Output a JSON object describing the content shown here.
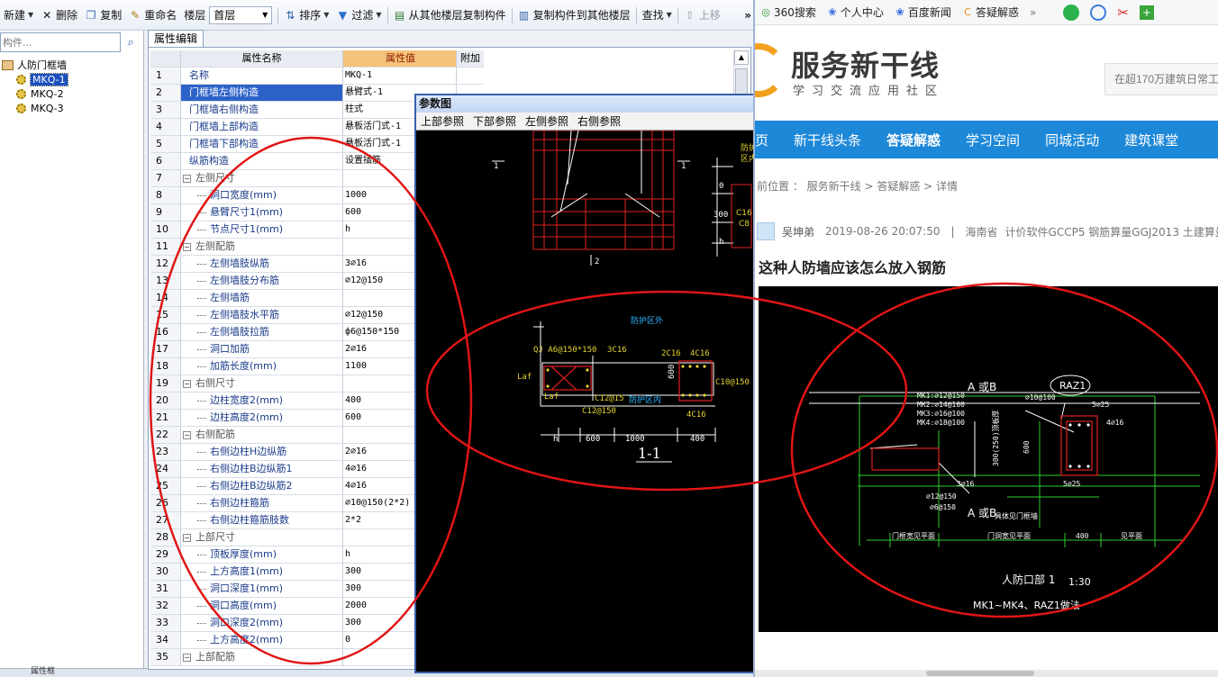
{
  "toolbar": {
    "new": "新建",
    "delete": "删除",
    "copy": "复制",
    "rename": "重命名",
    "floor_label": "楼层",
    "floor_value": "首层",
    "sort": "排序",
    "filter": "过滤",
    "copy_from_floor": "从其他楼层复制构件",
    "copy_to_floor": "复制构件到其他楼层",
    "find": "查找",
    "move_up": "上移"
  },
  "tree": {
    "search_placeholder": "构件...",
    "root": "人防门框墙",
    "items": [
      "MKQ-1",
      "MKQ-2",
      "MKQ-3"
    ],
    "selected": "MKQ-1"
  },
  "status": {
    "bottom_label": "属性框"
  },
  "property_panel": {
    "tab": "属性编辑",
    "headers": {
      "name": "属性名称",
      "value": "属性值",
      "extra": "附加"
    },
    "rows": [
      {
        "num": "1",
        "name": "名称",
        "value": "MKQ-1",
        "level": 1
      },
      {
        "num": "2",
        "name": "门框墙左侧构造",
        "value": "悬臂式-1",
        "level": 1,
        "selected": true
      },
      {
        "num": "3",
        "name": "门框墙右侧构造",
        "value": "柱式",
        "level": 1
      },
      {
        "num": "4",
        "name": "门框墙上部构造",
        "value": "悬板活门式-1",
        "level": 1
      },
      {
        "num": "5",
        "name": "门框墙下部构造",
        "value": "悬板活门式-1",
        "level": 1
      },
      {
        "num": "6",
        "name": "纵筋构造",
        "value": "设置插筋",
        "level": 1
      },
      {
        "num": "7",
        "name": "左侧尺寸",
        "value": "",
        "group": true
      },
      {
        "num": "8",
        "name": "洞口宽度(mm)",
        "value": "1000",
        "level": 2
      },
      {
        "num": "9",
        "name": "悬臂尺寸1(mm)",
        "value": "600",
        "level": 2
      },
      {
        "num": "10",
        "name": "节点尺寸1(mm)",
        "value": "h",
        "level": 2
      },
      {
        "num": "11",
        "name": "左侧配筋",
        "value": "",
        "group": true
      },
      {
        "num": "12",
        "name": "左侧墙肢纵筋",
        "value": "3⌀16",
        "level": 2
      },
      {
        "num": "13",
        "name": "左侧墙肢分布筋",
        "value": "⌀12@150",
        "level": 2
      },
      {
        "num": "14",
        "name": "左侧墙筋",
        "value": "",
        "level": 2
      },
      {
        "num": "15",
        "name": "左侧墙肢水平筋",
        "value": "⌀12@150",
        "level": 2
      },
      {
        "num": "16",
        "name": "左侧墙肢拉筋",
        "value": "ф6@150*150",
        "level": 2
      },
      {
        "num": "17",
        "name": "洞口加筋",
        "value": "2⌀16",
        "level": 2
      },
      {
        "num": "18",
        "name": "加筋长度(mm)",
        "value": "1100",
        "level": 2
      },
      {
        "num": "19",
        "name": "右侧尺寸",
        "value": "",
        "group": true
      },
      {
        "num": "20",
        "name": "边柱宽度2(mm)",
        "value": "400",
        "level": 2
      },
      {
        "num": "21",
        "name": "边柱高度2(mm)",
        "value": "600",
        "level": 2
      },
      {
        "num": "22",
        "name": "右侧配筋",
        "value": "",
        "group": true
      },
      {
        "num": "23",
        "name": "右侧边柱H边纵筋",
        "value": "2⌀16",
        "level": 2
      },
      {
        "num": "24",
        "name": "右侧边柱B边纵筋1",
        "value": "4⌀16",
        "level": 2
      },
      {
        "num": "25",
        "name": "右侧边柱B边纵筋2",
        "value": "4⌀16",
        "level": 2
      },
      {
        "num": "26",
        "name": "右侧边柱箍筋",
        "value": "⌀10@150(2*2)",
        "level": 2
      },
      {
        "num": "27",
        "name": "右侧边柱箍筋肢数",
        "value": "2*2",
        "level": 2
      },
      {
        "num": "28",
        "name": "上部尺寸",
        "value": "",
        "group": true
      },
      {
        "num": "29",
        "name": "顶板厚度(mm)",
        "value": "h",
        "level": 2
      },
      {
        "num": "30",
        "name": "上方高度1(mm)",
        "value": "300",
        "level": 2
      },
      {
        "num": "31",
        "name": "洞口深度1(mm)",
        "value": "300",
        "level": 2
      },
      {
        "num": "32",
        "name": "洞口高度(mm)",
        "value": "2000",
        "level": 2
      },
      {
        "num": "33",
        "name": "洞口深度2(mm)",
        "value": "300",
        "level": 2
      },
      {
        "num": "34",
        "name": "上方高度2(mm)",
        "value": "0",
        "level": 2
      },
      {
        "num": "35",
        "name": "上部配筋",
        "value": "",
        "group": true
      }
    ]
  },
  "drawing_popup": {
    "title": "参数图",
    "menu": [
      "上部参照",
      "下部参照",
      "左侧参照",
      "右侧参照"
    ],
    "labels": {
      "mark1": "1",
      "mark2": "2",
      "protect_out": "防护区外",
      "protect_in": "防护区内",
      "qj": "QJ A6@150*150",
      "c3": "3C16",
      "c2": "2C16",
      "c4a": "4C16",
      "c4b": "4C16",
      "c12a": "C12@15",
      "c12b": "C12@150",
      "c10": "C10@150",
      "laf1": "Laf",
      "laf2": "Laf",
      "h": "h",
      "d600a": "600",
      "d1000": "1000",
      "d400": "400",
      "d600b": "600",
      "section": "1-1",
      "side_a": "防护",
      "side_b": "区内",
      "d0": "0",
      "d300": "300",
      "dh": "h",
      "c16": "C16",
      "c8": "C8"
    }
  },
  "browser": {
    "bookmarks": [
      "360搜索",
      "个人中心",
      "百度新闻",
      "答疑解惑"
    ],
    "site_name": "服务新干线",
    "site_slogan": "学习交流应用社区",
    "search_placeholder": "在超170万建筑日常工",
    "nav": [
      "页",
      "新干线头条",
      "答疑解惑",
      "学习空间",
      "同城活动",
      "建筑课堂"
    ],
    "nav_active": "答疑解惑",
    "breadcrumb": "前位置 ： 服务新干线 > 答疑解惑 > 详情",
    "author": "吴坤弟",
    "datetime": "2019-08-26 20:07:50",
    "region": "海南省",
    "tags": "计价软件GCCP5 钢筋算量GGJ2013 土建算量",
    "question_title": "这种人防墙应该怎么放入钢筋",
    "image_labels": {
      "ab1": "A 或B",
      "ab2": "A 或B",
      "raz": "RAZ1",
      "mk1": "MK1:⌀12@150",
      "mk2": "MK2:⌀14@100",
      "mk3": "MK3:⌀16@100",
      "mk4": "MK4:⌀18@100",
      "phi10": "⌀10@100",
      "c5a": "5⌀25",
      "c5b": "5⌀25",
      "c4": "4⌀16",
      "c3": "3⌀16",
      "phi12": "⌀12@150",
      "phi6": "⌀6@150",
      "d600": "600",
      "d400": "400",
      "dim_note": "300(250)顶板厚",
      "mk_note": "具体见门框墙",
      "l1": "门框宽见平面",
      "l2": "门洞宽见平面",
      "l3": "见平面",
      "caption": "人防口部 1",
      "scale": "1:30",
      "caption2": "MK1~MK4、RAZ1做法"
    }
  }
}
